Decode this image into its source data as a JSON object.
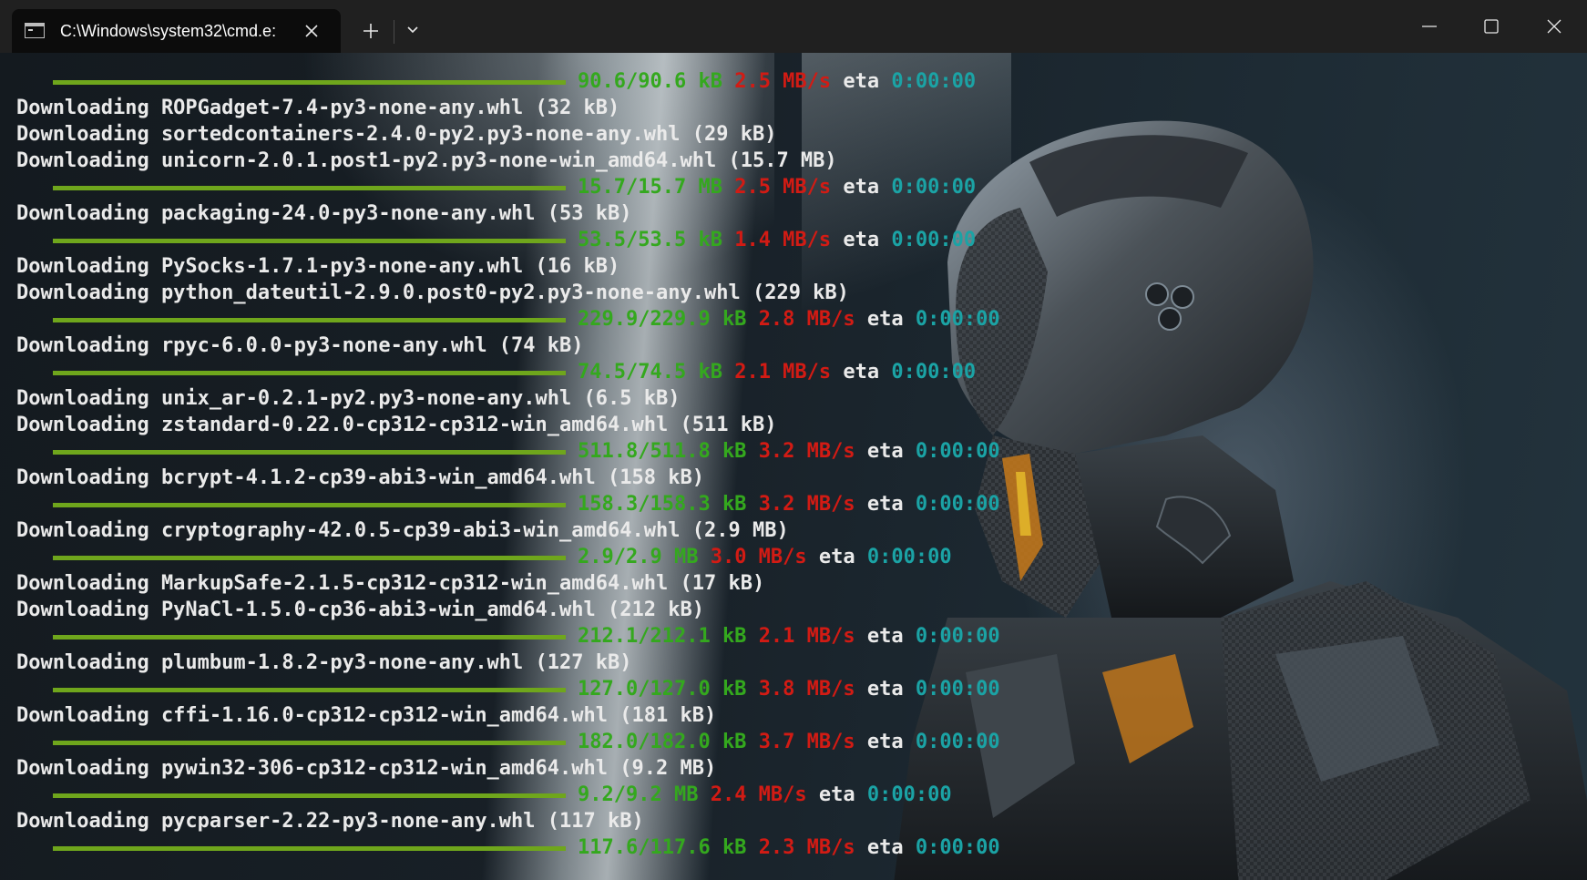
{
  "window": {
    "tab_title": "C:\\Windows\\system32\\cmd.e:",
    "tab_icon": "terminal-icon",
    "new_tab_label": "+",
    "close_tab_label": "×"
  },
  "colors": {
    "progress_bar": "#6fa61c",
    "size_text": "#34a81e",
    "speed_text": "#d21b14",
    "eta_text": "#1ba3a5",
    "default_text": "#eaeaea"
  },
  "terminal": {
    "lines": [
      {
        "type": "progress",
        "size": "90.6/90.6 kB",
        "speed": "2.5 MB/s",
        "eta_label": "eta",
        "eta": "0:00:00"
      },
      {
        "type": "text",
        "text": "Downloading ROPGadget-7.4-py3-none-any.whl (32 kB)"
      },
      {
        "type": "text",
        "text": "Downloading sortedcontainers-2.4.0-py2.py3-none-any.whl (29 kB)"
      },
      {
        "type": "text",
        "text": "Downloading unicorn-2.0.1.post1-py2.py3-none-win_amd64.whl (15.7 MB)"
      },
      {
        "type": "progress",
        "size": "15.7/15.7 MB",
        "speed": "2.5 MB/s",
        "eta_label": "eta",
        "eta": "0:00:00"
      },
      {
        "type": "text",
        "text": "Downloading packaging-24.0-py3-none-any.whl (53 kB)"
      },
      {
        "type": "progress",
        "size": "53.5/53.5 kB",
        "speed": "1.4 MB/s",
        "eta_label": "eta",
        "eta": "0:00:00"
      },
      {
        "type": "text",
        "text": "Downloading PySocks-1.7.1-py3-none-any.whl (16 kB)"
      },
      {
        "type": "text",
        "text": "Downloading python_dateutil-2.9.0.post0-py2.py3-none-any.whl (229 kB)"
      },
      {
        "type": "progress",
        "size": "229.9/229.9 kB",
        "speed": "2.8 MB/s",
        "eta_label": "eta",
        "eta": "0:00:00"
      },
      {
        "type": "text",
        "text": "Downloading rpyc-6.0.0-py3-none-any.whl (74 kB)"
      },
      {
        "type": "progress",
        "size": "74.5/74.5 kB",
        "speed": "2.1 MB/s",
        "eta_label": "eta",
        "eta": "0:00:00"
      },
      {
        "type": "text",
        "text": "Downloading unix_ar-0.2.1-py2.py3-none-any.whl (6.5 kB)"
      },
      {
        "type": "text",
        "text": "Downloading zstandard-0.22.0-cp312-cp312-win_amd64.whl (511 kB)"
      },
      {
        "type": "progress",
        "size": "511.8/511.8 kB",
        "speed": "3.2 MB/s",
        "eta_label": "eta",
        "eta": "0:00:00"
      },
      {
        "type": "text",
        "text": "Downloading bcrypt-4.1.2-cp39-abi3-win_amd64.whl (158 kB)"
      },
      {
        "type": "progress",
        "size": "158.3/158.3 kB",
        "speed": "3.2 MB/s",
        "eta_label": "eta",
        "eta": "0:00:00"
      },
      {
        "type": "text",
        "text": "Downloading cryptography-42.0.5-cp39-abi3-win_amd64.whl (2.9 MB)"
      },
      {
        "type": "progress",
        "size": "2.9/2.9 MB",
        "speed": "3.0 MB/s",
        "eta_label": "eta",
        "eta": "0:00:00"
      },
      {
        "type": "text",
        "text": "Downloading MarkupSafe-2.1.5-cp312-cp312-win_amd64.whl (17 kB)"
      },
      {
        "type": "text",
        "text": "Downloading PyNaCl-1.5.0-cp36-abi3-win_amd64.whl (212 kB)"
      },
      {
        "type": "progress",
        "size": "212.1/212.1 kB",
        "speed": "2.1 MB/s",
        "eta_label": "eta",
        "eta": "0:00:00"
      },
      {
        "type": "text",
        "text": "Downloading plumbum-1.8.2-py3-none-any.whl (127 kB)"
      },
      {
        "type": "progress",
        "size": "127.0/127.0 kB",
        "speed": "3.8 MB/s",
        "eta_label": "eta",
        "eta": "0:00:00"
      },
      {
        "type": "text",
        "text": "Downloading cffi-1.16.0-cp312-cp312-win_amd64.whl (181 kB)"
      },
      {
        "type": "progress",
        "size": "182.0/182.0 kB",
        "speed": "3.7 MB/s",
        "eta_label": "eta",
        "eta": "0:00:00"
      },
      {
        "type": "text",
        "text": "Downloading pywin32-306-cp312-cp312-win_amd64.whl (9.2 MB)"
      },
      {
        "type": "progress",
        "size": "9.2/9.2 MB",
        "speed": "2.4 MB/s",
        "eta_label": "eta",
        "eta": "0:00:00"
      },
      {
        "type": "text",
        "text": "Downloading pycparser-2.22-py3-none-any.whl (117 kB)"
      },
      {
        "type": "progress",
        "size": "117.6/117.6 kB",
        "speed": "2.3 MB/s",
        "eta_label": "eta",
        "eta": "0:00:00"
      }
    ]
  }
}
